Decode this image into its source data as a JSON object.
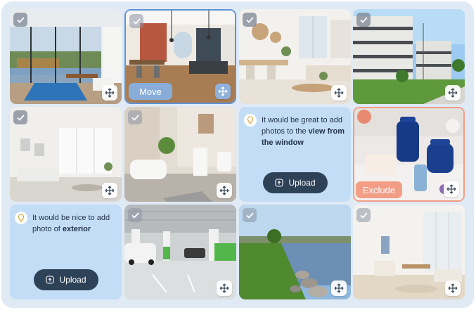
{
  "tiles": {
    "move_label": "Move",
    "exclude_label": "Exclude"
  },
  "prompts": {
    "window": {
      "text_prefix": "It would be great to add photos to the ",
      "text_bold": "view from the window",
      "button_label": "Upload"
    },
    "exterior": {
      "text_prefix": "It would be nice to add photo of ",
      "text_bold": "exterior",
      "button_label": "Upload"
    }
  },
  "icons": {
    "check": "check-icon",
    "move": "move-arrows-icon",
    "bulb": "lightbulb-icon",
    "upload": "upload-icon"
  },
  "colors": {
    "panel_bg": "#dfeaf5",
    "prompt_bg": "#c4ddf7",
    "selected_border": "#5f93d6",
    "exclude_accent": "#f29d86",
    "upload_button": "#2e4257"
  }
}
